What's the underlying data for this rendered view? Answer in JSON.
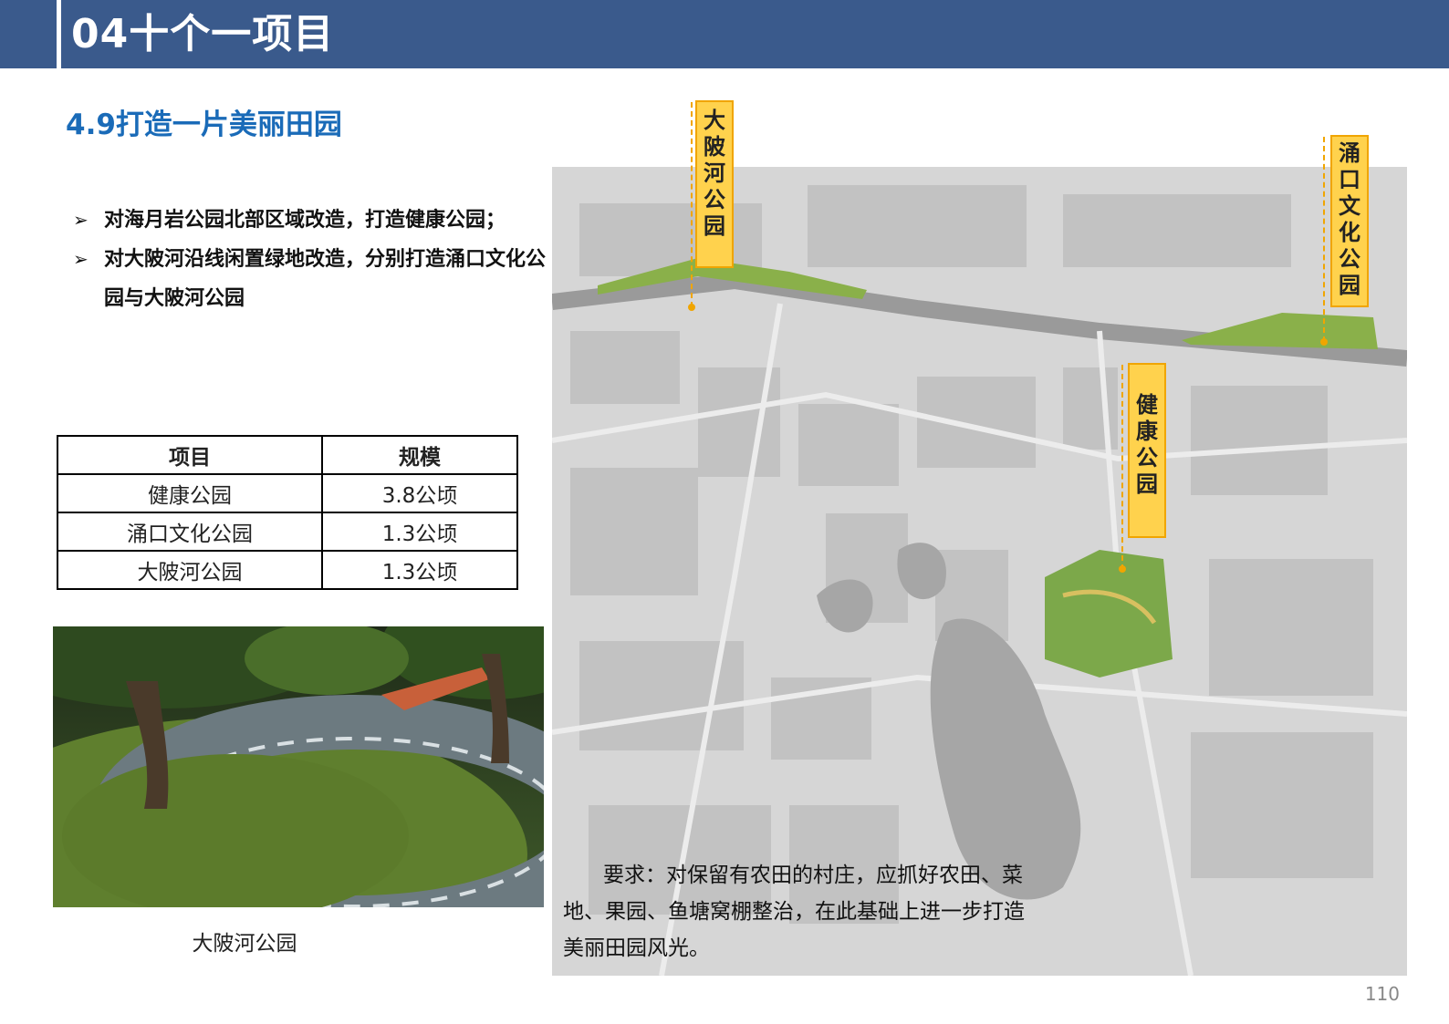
{
  "header": {
    "title": "04十个一项目"
  },
  "section": {
    "title": "4.9打造一片美丽田园"
  },
  "bullets": [
    {
      "text": "对海月岩公园北部区域改造，打造健康公园；"
    },
    {
      "text": "对大陂河沿线闲置绿地改造，分别打造涌口文化公园与大陂河公园"
    }
  ],
  "table": {
    "headers": [
      "项目",
      "规模"
    ],
    "rows": [
      [
        "健康公园",
        "3.8公顷"
      ],
      [
        "涌口文化公园",
        "1.3公顷"
      ],
      [
        "大陂河公园",
        "1.3公顷"
      ]
    ]
  },
  "photo": {
    "caption": "大陂河公园"
  },
  "map_labels": {
    "dabeihe": "大陂河公园",
    "yongkou": "涌口文化公园",
    "jiankang": "健康公园"
  },
  "requirement": "要求：对保留有农田的村庄，应抓好农田、菜地、果园、鱼塘窝棚整治，在此基础上进一步打造美丽田园风光。",
  "page_number": "110",
  "colors": {
    "header_bg": "#3a5a8c",
    "title_blue": "#1a6bb8",
    "label_fill": "#ffd24d",
    "label_border": "#f0a500"
  }
}
